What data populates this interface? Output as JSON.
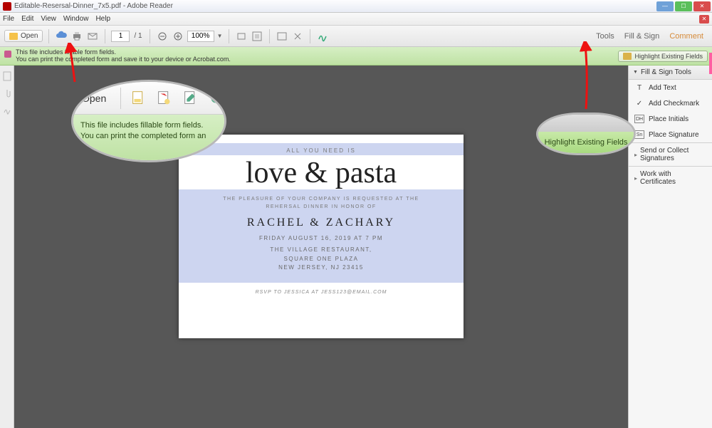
{
  "title_bar": {
    "text": "Editable-Resersal-Dinner_7x5.pdf - Adobe Reader"
  },
  "menu": {
    "file": "File",
    "edit": "Edit",
    "view": "View",
    "window": "Window",
    "help": "Help"
  },
  "toolbar": {
    "open_label": "Open",
    "page_current": "1",
    "page_total": "/ 1",
    "zoom_value": "100%",
    "tools": "Tools",
    "fill_sign": "Fill & Sign",
    "comment": "Comment"
  },
  "info_bar": {
    "line1": "This file includes fillable form fields.",
    "line2": "You can print the completed form and save it to your device or Acrobat.com.",
    "highlight_btn": "Highlight Existing Fields"
  },
  "right_panel": {
    "header": "Fill & Sign Tools",
    "items": {
      "add_text": "Add Text",
      "add_checkmark": "Add Checkmark",
      "place_initials": "Place Initials",
      "place_signature": "Place Signature"
    },
    "sections": {
      "send_collect": "Send or Collect Signatures",
      "work_certs": "Work with Certificates"
    }
  },
  "document": {
    "pretitle": "ALL YOU NEED IS",
    "title": "love & pasta",
    "subtitle1": "THE PLEASURE OF YOUR COMPANY IS REQUESTED AT THE",
    "subtitle2": "REHERSAL DINNER IN HONOR OF",
    "names": "RACHEL & ZACHARY",
    "date": "FRIDAY AUGUST 16, 2019 AT 7 PM",
    "venue_line1": "THE VILLAGE RESTAURANT,",
    "venue_line2": "SQUARE ONE PLAZA",
    "venue_line3": "NEW JERSEY, NJ 23415",
    "rsvp": "RSVP TO JESSICA AT JESS123@EMAIL.COM"
  },
  "callouts": {
    "big_open": "Open",
    "big_line1": "This file includes fillable form fields.",
    "big_line2": "You can print the completed form an",
    "small_text": "Highlight Existing Fields"
  }
}
